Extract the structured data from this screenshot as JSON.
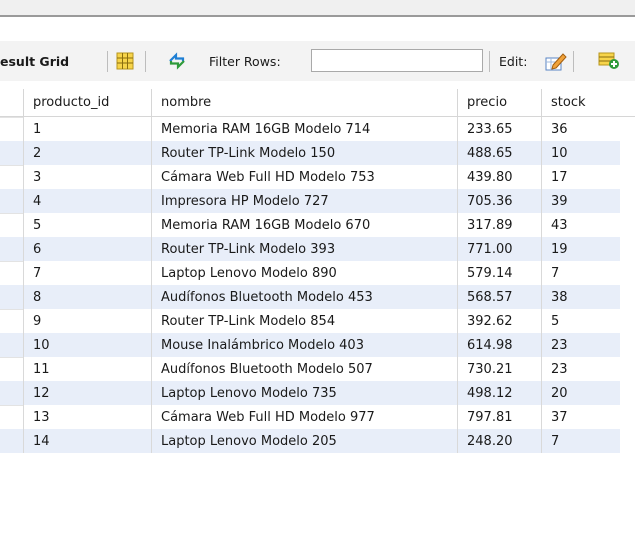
{
  "toolbar": {
    "result_grid_label": "esult Grid",
    "filter_label": "Filter Rows:",
    "filter_value": "",
    "edit_label": "Edit:"
  },
  "columns": [
    "producto_id",
    "nombre",
    "precio",
    "stock"
  ],
  "rows": [
    [
      "1",
      "Memoria RAM 16GB Modelo 714",
      "233.65",
      "36"
    ],
    [
      "2",
      "Router TP-Link Modelo 150",
      "488.65",
      "10"
    ],
    [
      "3",
      "Cámara Web Full HD Modelo 753",
      "439.80",
      "17"
    ],
    [
      "4",
      "Impresora HP Modelo 727",
      "705.36",
      "39"
    ],
    [
      "5",
      "Memoria RAM 16GB Modelo 670",
      "317.89",
      "43"
    ],
    [
      "6",
      "Router TP-Link Modelo 393",
      "771.00",
      "19"
    ],
    [
      "7",
      "Laptop Lenovo Modelo 890",
      "579.14",
      "7"
    ],
    [
      "8",
      "Audífonos Bluetooth Modelo 453",
      "568.57",
      "38"
    ],
    [
      "9",
      "Router TP-Link Modelo 854",
      "392.62",
      "5"
    ],
    [
      "10",
      "Mouse Inalámbrico Modelo 403",
      "614.98",
      "23"
    ],
    [
      "11",
      "Audífonos Bluetooth Modelo 507",
      "730.21",
      "23"
    ],
    [
      "12",
      "Laptop Lenovo Modelo 735",
      "498.12",
      "20"
    ],
    [
      "13",
      "Cámara Web Full HD Modelo 977",
      "797.81",
      "37"
    ],
    [
      "14",
      "Laptop Lenovo Modelo 205",
      "248.20",
      "7"
    ]
  ],
  "icons": {
    "grid_layout": "grid-layout-icon",
    "refresh": "refresh-arrows-icon",
    "edit": "pencil-edit-icon",
    "add_row": "add-row-icon"
  },
  "colors": {
    "row_alt": "#e8eef9",
    "accent": "#1e7fd4"
  }
}
